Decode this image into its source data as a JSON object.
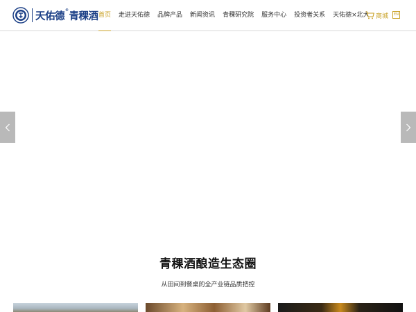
{
  "brand": {
    "logo_text": "天佑德",
    "logo_text2": "青稞酒",
    "reg_mark": "®",
    "primary_color": "#1b3f86",
    "accent_color": "#c9a227"
  },
  "nav": {
    "items": [
      {
        "label": "首页",
        "active": true
      },
      {
        "label": "走进天佑德"
      },
      {
        "label": "品牌产品"
      },
      {
        "label": "新闻资讯"
      },
      {
        "label": "青稞研究院"
      },
      {
        "label": "服务中心"
      },
      {
        "label": "投资者关系"
      },
      {
        "label": "天佑德×北大"
      }
    ],
    "shop_label": "商城",
    "shop_icon": "cart-icon",
    "lang_label": "EN"
  },
  "carousel": {
    "prev_icon": "chevron-left-icon",
    "next_icon": "chevron-right-icon"
  },
  "section": {
    "title": "青稞酒酿造生态圈",
    "subtitle": "从田间到餐桌的全产业链品质把控"
  }
}
